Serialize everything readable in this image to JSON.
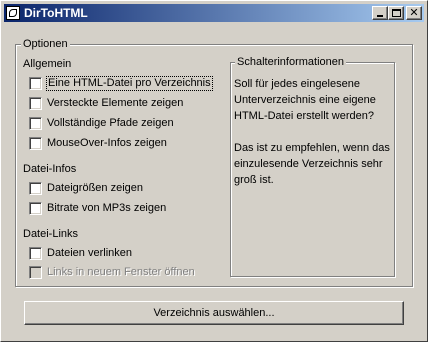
{
  "window": {
    "title": "DirToHTML"
  },
  "options_group": {
    "legend": "Optionen"
  },
  "sections": {
    "allgemein": {
      "label": "Allgemein",
      "items": [
        {
          "label": "Eine HTML-Datei pro Verzeichnis",
          "checked": false
        },
        {
          "label": "Versteckte Elemente zeigen",
          "checked": false
        },
        {
          "label": "Vollständige Pfade zeigen",
          "checked": false
        },
        {
          "label": "MouseOver-Infos zeigen",
          "checked": false
        }
      ]
    },
    "datei_infos": {
      "label": "Datei-Infos",
      "items": [
        {
          "label": "Dateigrößen zeigen",
          "checked": false
        },
        {
          "label": "Bitrate von MP3s zeigen",
          "checked": false
        }
      ]
    },
    "datei_links": {
      "label": "Datei-Links",
      "items": [
        {
          "label": "Dateien verlinken",
          "checked": false
        },
        {
          "label": "Links in neuem Fenster öffnen",
          "checked": false,
          "disabled": true
        }
      ]
    }
  },
  "info_group": {
    "legend": "Schalterinformationen",
    "text": "Soll für jedes eingelesene\nUnterverzeichnis eine eigene\nHTML-Datei erstellt werden?\n\nDas ist zu empfehlen, wenn das\neinzulesende Verzeichnis sehr\ngroß ist."
  },
  "select_button": {
    "label": "Verzeichnis auswählen..."
  },
  "title_buttons": {
    "close_glyph": "✕"
  }
}
